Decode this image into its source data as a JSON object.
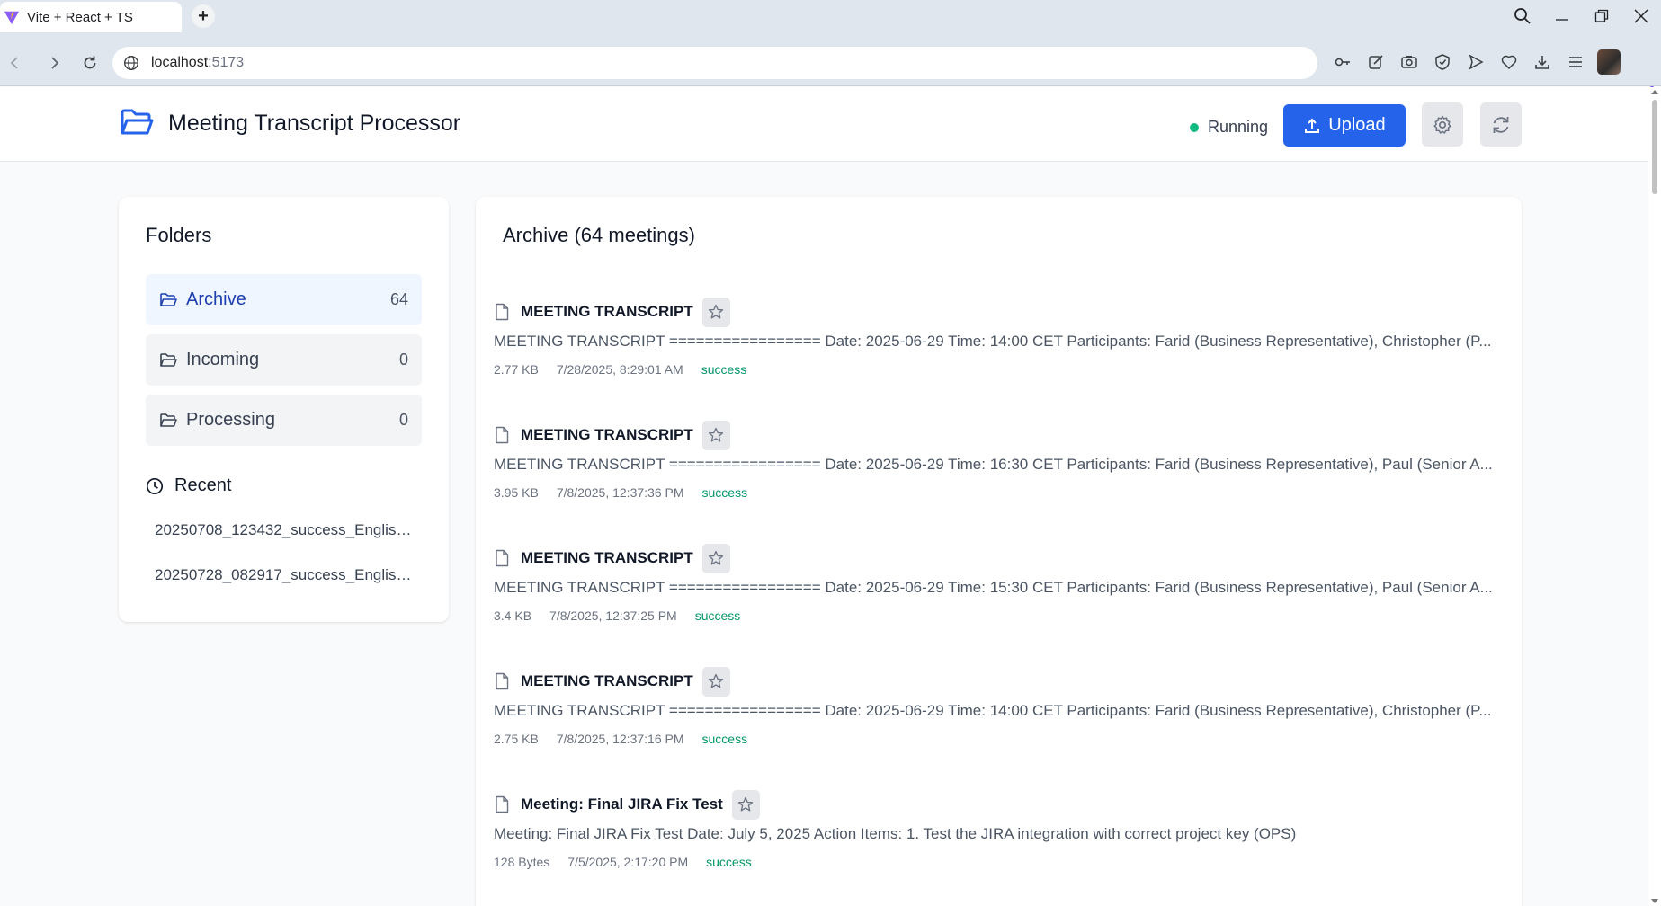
{
  "browser": {
    "tab_title": "Vite + React + TS",
    "url_host": "localhost",
    "url_port": ":5173"
  },
  "header": {
    "title": "Meeting Transcript Processor",
    "status": "Running",
    "upload_label": "Upload"
  },
  "folders": {
    "heading": "Folders",
    "items": [
      {
        "label": "Archive",
        "count": "64"
      },
      {
        "label": "Incoming",
        "count": "0"
      },
      {
        "label": "Processing",
        "count": "0"
      }
    ],
    "recent_heading": "Recent",
    "recent": [
      "20250708_123432_success_English_...",
      "20250728_082917_success_English_..."
    ]
  },
  "main": {
    "heading": "Archive (64 meetings)",
    "meetings": [
      {
        "title": "MEETING TRANSCRIPT",
        "preview": "MEETING TRANSCRIPT ================= Date: 2025-06-29 Time: 14:00 CET Participants: Farid (Business Representative), Christopher (P...",
        "size": "2.77 KB",
        "date": "7/28/2025, 8:29:01 AM",
        "status": "success"
      },
      {
        "title": "MEETING TRANSCRIPT",
        "preview": "MEETING TRANSCRIPT ================= Date: 2025-06-29 Time: 16:30 CET Participants: Farid (Business Representative), Paul (Senior A...",
        "size": "3.95 KB",
        "date": "7/8/2025, 12:37:36 PM",
        "status": "success"
      },
      {
        "title": "MEETING TRANSCRIPT",
        "preview": "MEETING TRANSCRIPT ================= Date: 2025-06-29 Time: 15:30 CET Participants: Farid (Business Representative), Paul (Senior A...",
        "size": "3.4 KB",
        "date": "7/8/2025, 12:37:25 PM",
        "status": "success"
      },
      {
        "title": "MEETING TRANSCRIPT",
        "preview": "MEETING TRANSCRIPT ================= Date: 2025-06-29 Time: 14:00 CET Participants: Farid (Business Representative), Christopher (P...",
        "size": "2.75 KB",
        "date": "7/8/2025, 12:37:16 PM",
        "status": "success"
      },
      {
        "title": "Meeting: Final JIRA Fix Test",
        "preview": "Meeting: Final JIRA Fix Test Date: July 5, 2025 Action Items: 1. Test the JIRA integration with correct project key (OPS)",
        "size": "128 Bytes",
        "date": "7/5/2025, 2:17:20 PM",
        "status": "success"
      }
    ]
  },
  "colors": {
    "accent": "#2563eb",
    "status_running": "#10b981",
    "status_success": "#059669"
  }
}
